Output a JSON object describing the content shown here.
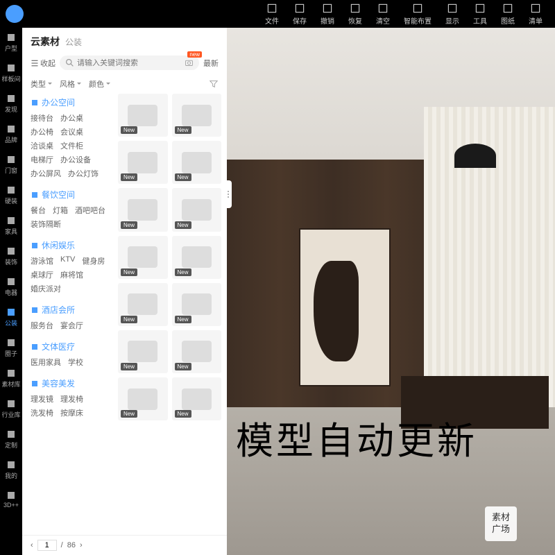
{
  "topbar": {
    "buttons": [
      {
        "label": "文件",
        "icon": "file"
      },
      {
        "label": "保存",
        "icon": "save"
      },
      {
        "label": "撤销",
        "icon": "undo"
      },
      {
        "label": "恢复",
        "icon": "redo"
      },
      {
        "label": "清空",
        "icon": "clear"
      },
      {
        "label": "智能布置",
        "icon": "auto"
      },
      {
        "label": "显示",
        "icon": "display"
      },
      {
        "label": "工具",
        "icon": "tool"
      },
      {
        "label": "图纸",
        "icon": "drawing"
      },
      {
        "label": "清单",
        "icon": "list"
      }
    ]
  },
  "leftbar": {
    "items": [
      {
        "label": "户型"
      },
      {
        "label": "样板间"
      },
      {
        "label": "发现"
      },
      {
        "label": "品牌"
      },
      {
        "label": "门窗"
      },
      {
        "label": "硬装"
      },
      {
        "label": "家具"
      },
      {
        "label": "装饰"
      },
      {
        "label": "电器"
      },
      {
        "label": "公装",
        "active": true
      },
      {
        "label": "圈子"
      },
      {
        "label": "素材库"
      },
      {
        "label": "行业库"
      },
      {
        "label": "定制"
      },
      {
        "label": "我的"
      },
      {
        "label": "3D++"
      }
    ]
  },
  "panel": {
    "title": "云素材",
    "subtitle": "公装",
    "collapse": "收起",
    "search_placeholder": "请输入关键词搜索",
    "new_badge": "new",
    "sort": "最新",
    "filters": [
      "类型",
      "风格",
      "颜色"
    ],
    "categories": [
      {
        "name": "办公空间",
        "items": [
          "接待台",
          "办公桌",
          "办公椅",
          "会议桌",
          "洽谈桌",
          "文件柜",
          "电梯厅",
          "办公设备",
          "办公屏风",
          "办公灯饰"
        ]
      },
      {
        "name": "餐饮空间",
        "items": [
          "餐台",
          "灯箱",
          "酒吧吧台",
          "装饰隔断"
        ]
      },
      {
        "name": "休闲娱乐",
        "items": [
          "游泳馆",
          "KTV",
          "健身房",
          "桌球厅",
          "麻将馆",
          "婚庆派对"
        ]
      },
      {
        "name": "酒店会所",
        "items": [
          "服务台",
          "宴会厅"
        ]
      },
      {
        "name": "文体医疗",
        "items": [
          "医用家具",
          "学校"
        ]
      },
      {
        "name": "美容美发",
        "items": [
          "理发镜",
          "理发椅",
          "洗发椅",
          "按摩床"
        ]
      }
    ],
    "card_tag": "New",
    "pager": {
      "current": "1",
      "total": "86",
      "sep": "/"
    }
  },
  "overlay": "模型自动更新",
  "plaza": "素材\n广场"
}
